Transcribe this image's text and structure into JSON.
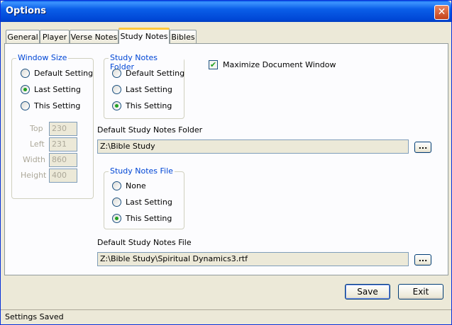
{
  "window": {
    "title": "Options",
    "close_label": "✕"
  },
  "tabs": [
    {
      "label": "General"
    },
    {
      "label": "Player"
    },
    {
      "label": "Verse Notes"
    },
    {
      "label": "Study Notes"
    },
    {
      "label": "Bibles"
    }
  ],
  "active_tab": "Study Notes",
  "window_size": {
    "title": "Window Size",
    "options": [
      "Default Setting",
      "Last Setting",
      "This Setting"
    ],
    "selected": "Last Setting",
    "fields": [
      {
        "label": "Top",
        "value": "230"
      },
      {
        "label": "Left",
        "value": "231"
      },
      {
        "label": "Width",
        "value": "860"
      },
      {
        "label": "Height",
        "value": "400"
      }
    ]
  },
  "study_notes_folder": {
    "title": "Study Notes Folder",
    "options": [
      "Default Setting",
      "Last Setting",
      "This Setting"
    ],
    "selected": "This Setting"
  },
  "maximize": {
    "label": "Maximize Document Window",
    "checked": true,
    "check_glyph": "✔"
  },
  "default_folder": {
    "label": "Default Study Notes Folder",
    "value": "Z:\\Bible Study",
    "browse_label": "..."
  },
  "study_notes_file": {
    "title": "Study Notes File",
    "options": [
      "None",
      "Last Setting",
      "This Setting"
    ],
    "selected": "This Setting"
  },
  "default_file": {
    "label": "Default Study Notes File",
    "value": "Z:\\Bible Study\\Spiritual Dynamics3.rtf",
    "browse_label": "..."
  },
  "buttons": {
    "save": "Save",
    "exit": "Exit"
  },
  "status": {
    "text": "Settings Saved"
  },
  "colors": {
    "title_bar": "#0a5ee8",
    "group_title": "#0046d5",
    "active_tab_accent": "#ffc83c",
    "radio_dot": "#21a121"
  }
}
